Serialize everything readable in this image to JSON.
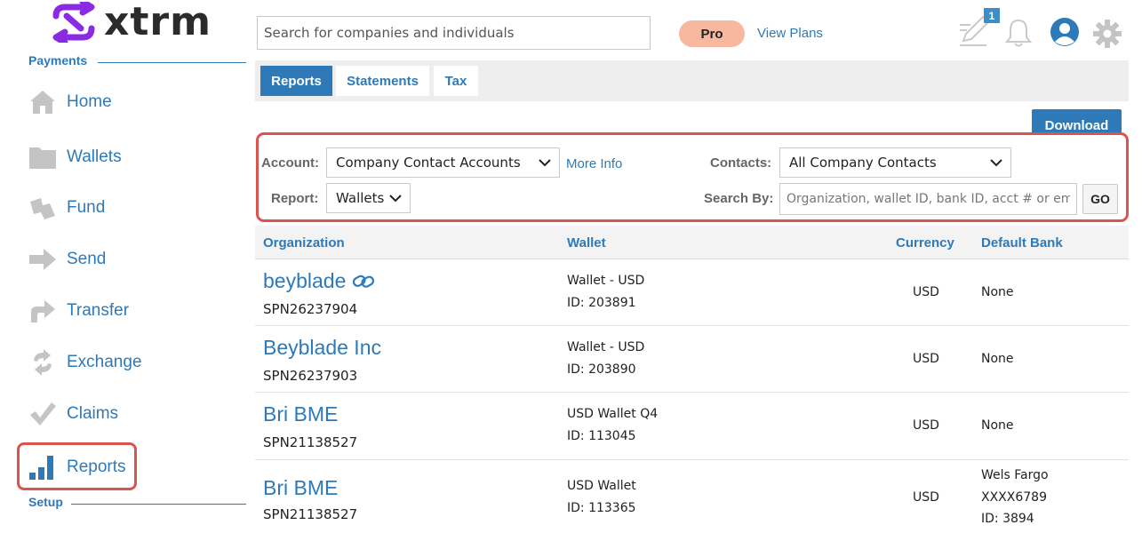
{
  "brand": {
    "logo_text": "xtrm",
    "logo_color": "#8a2be2"
  },
  "sidebar": {
    "payments_title": "Payments",
    "setup_title": "Setup",
    "items": [
      {
        "label": "Home",
        "icon": "home-icon"
      },
      {
        "label": "Wallets",
        "icon": "folder-icon"
      },
      {
        "label": "Fund",
        "icon": "fund-arrow-icon"
      },
      {
        "label": "Send",
        "icon": "send-arrow-icon"
      },
      {
        "label": "Transfer",
        "icon": "transfer-arrow-icon"
      },
      {
        "label": "Exchange",
        "icon": "exchange-icon"
      },
      {
        "label": "Claims",
        "icon": "checkmark-icon"
      },
      {
        "label": "Reports",
        "icon": "bar-chart-icon",
        "active": true
      }
    ]
  },
  "header": {
    "search_placeholder": "Search for companies and individuals",
    "pro_label": "Pro",
    "view_plans": "View Plans",
    "notification_count": "1",
    "accent": "#2e7ab8",
    "pro_color": "#f8b8a0"
  },
  "tabs": [
    {
      "label": "Reports",
      "active": true
    },
    {
      "label": "Statements",
      "active": false
    },
    {
      "label": "Tax",
      "active": false
    }
  ],
  "download_label": "Download",
  "filters": {
    "account_label": "Account:",
    "account_value": "Company Contact Accounts",
    "more_info": "More Info",
    "contacts_label": "Contacts:",
    "contacts_value": "All Company Contacts",
    "report_label": "Report:",
    "report_value": "Wallets",
    "search_by_label": "Search By:",
    "search_by_placeholder": "Organization, wallet ID, bank ID, acct # or email",
    "go_label": "GO"
  },
  "table": {
    "headers": [
      "Organization",
      "Wallet",
      "Currency",
      "Default Bank"
    ],
    "rows": [
      {
        "org": "beyblade",
        "linked": true,
        "org_id": "SPN26237904",
        "wallet": "Wallet - USD",
        "wallet_id": "ID: 203891",
        "currency": "USD",
        "bank": [
          "None"
        ]
      },
      {
        "org": "Beyblade Inc",
        "linked": false,
        "org_id": "SPN26237903",
        "wallet": "Wallet - USD",
        "wallet_id": "ID: 203890",
        "currency": "USD",
        "bank": [
          "None"
        ]
      },
      {
        "org": "Bri BME",
        "linked": false,
        "org_id": "SPN21138527",
        "wallet": "USD Wallet Q4",
        "wallet_id": "ID: 113045",
        "currency": "USD",
        "bank": [
          "None"
        ]
      },
      {
        "org": "Bri BME",
        "linked": false,
        "org_id": "SPN21138527",
        "wallet": "USD Wallet",
        "wallet_id": "ID: 113365",
        "currency": "USD",
        "bank": [
          "Wels Fargo",
          "XXXX6789",
          "ID: 3894"
        ]
      }
    ]
  }
}
